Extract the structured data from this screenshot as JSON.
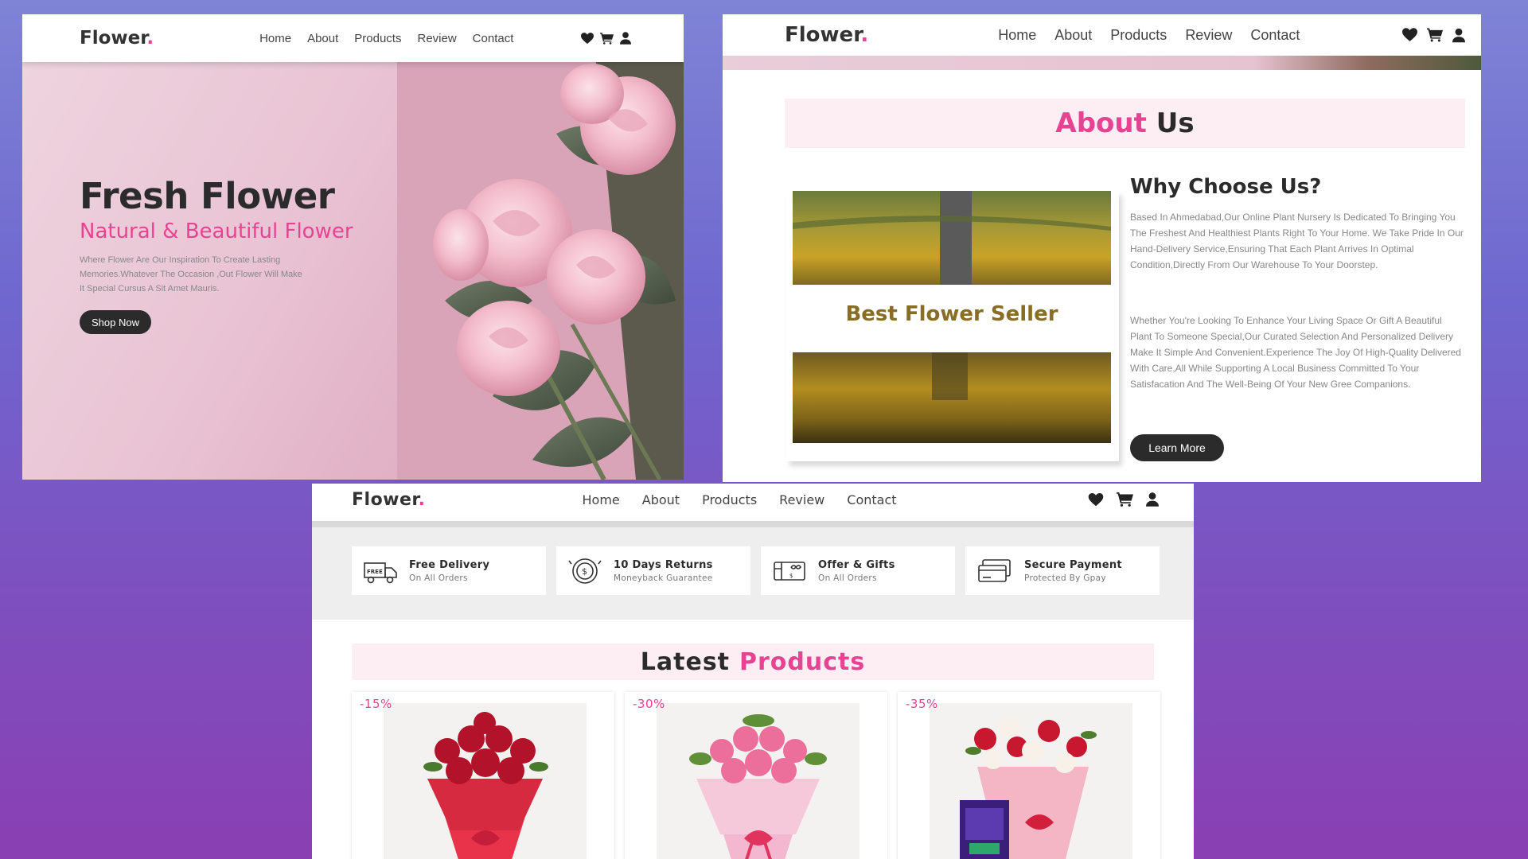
{
  "colors": {
    "accent": "#e84393",
    "dark": "#2b2b2b",
    "background_gradient": [
      "#7f84d6",
      "#8a3fb2"
    ]
  },
  "home": {
    "nav": {
      "brand": "Flower",
      "brand_dot": ".",
      "links": [
        "Home",
        "About",
        "Products",
        "Review",
        "Contact"
      ],
      "icons": [
        "heart-icon",
        "cart-icon",
        "user-icon"
      ]
    },
    "hero": {
      "title": "Fresh Flower",
      "subtitle": "Natural & Beautiful Flower",
      "text": "Where Flower Are Our Inspiration To Create Lasting Memories.Whatever The Occasion ,Out Flower Will Make It Special Cursus A Sit Amet Mauris.",
      "button": "Shop Now"
    }
  },
  "about": {
    "nav": {
      "brand": "Flower",
      "brand_dot": ".",
      "links": [
        "Home",
        "About",
        "Products",
        "Review",
        "Contact"
      ],
      "icons": [
        "heart-icon",
        "cart-icon",
        "user-icon"
      ]
    },
    "heading_accent": "About",
    "heading_rest": "Us",
    "image_caption": "Best Flower Seller",
    "why_title": "Why Choose Us?",
    "paragraph_1": "Based In Ahmedabad,Our Online Plant Nursery Is Dedicated To Bringing You The Freshest And Healthiest Plants Right To Your Home. We Take Pride In Our Hand-Delivery Service,Ensuring That Each Plant Arrives In Optimal Condition,Directly From Our Warehouse To Your Doorstep.",
    "paragraph_2": "Whether You're Looking To Enhance Your Living Space Or Gift A Beautiful Plant To Someone Special,Our Curated Selection And Personalized Delivery Make It Simple And Convenient.Experience The Joy Of High-Quality Delivered With Care,All While Supporting A Local Business Committed To Your Satisfacation And The Well-Being Of Your New Gree Companions.",
    "button": "Learn More"
  },
  "products": {
    "nav": {
      "brand": "Flower",
      "brand_dot": ".",
      "links": [
        "Home",
        "About",
        "Products",
        "Review",
        "Contact"
      ],
      "icons": [
        "heart-icon",
        "cart-icon",
        "user-icon"
      ]
    },
    "features": [
      {
        "icon": "free-delivery-truck-icon",
        "title": "Free Delivery",
        "subtitle": "On All Orders"
      },
      {
        "icon": "returns-clock-icon",
        "title": "10 Days Returns",
        "subtitle": "Moneyback Guarantee"
      },
      {
        "icon": "gift-voucher-icon",
        "title": "Offer & Gifts",
        "subtitle": "On All Orders"
      },
      {
        "icon": "credit-card-icon",
        "title": "Secure Payment",
        "subtitle": "Protected By Gpay"
      }
    ],
    "heading_dark": "Latest",
    "heading_accent": "Products",
    "items": [
      {
        "discount": "-15%",
        "image": "red-rose-bouquet"
      },
      {
        "discount": "-30%",
        "image": "pink-rose-bouquet"
      },
      {
        "discount": "-35%",
        "image": "mixed-rose-bouquet-with-chocolates"
      }
    ]
  }
}
